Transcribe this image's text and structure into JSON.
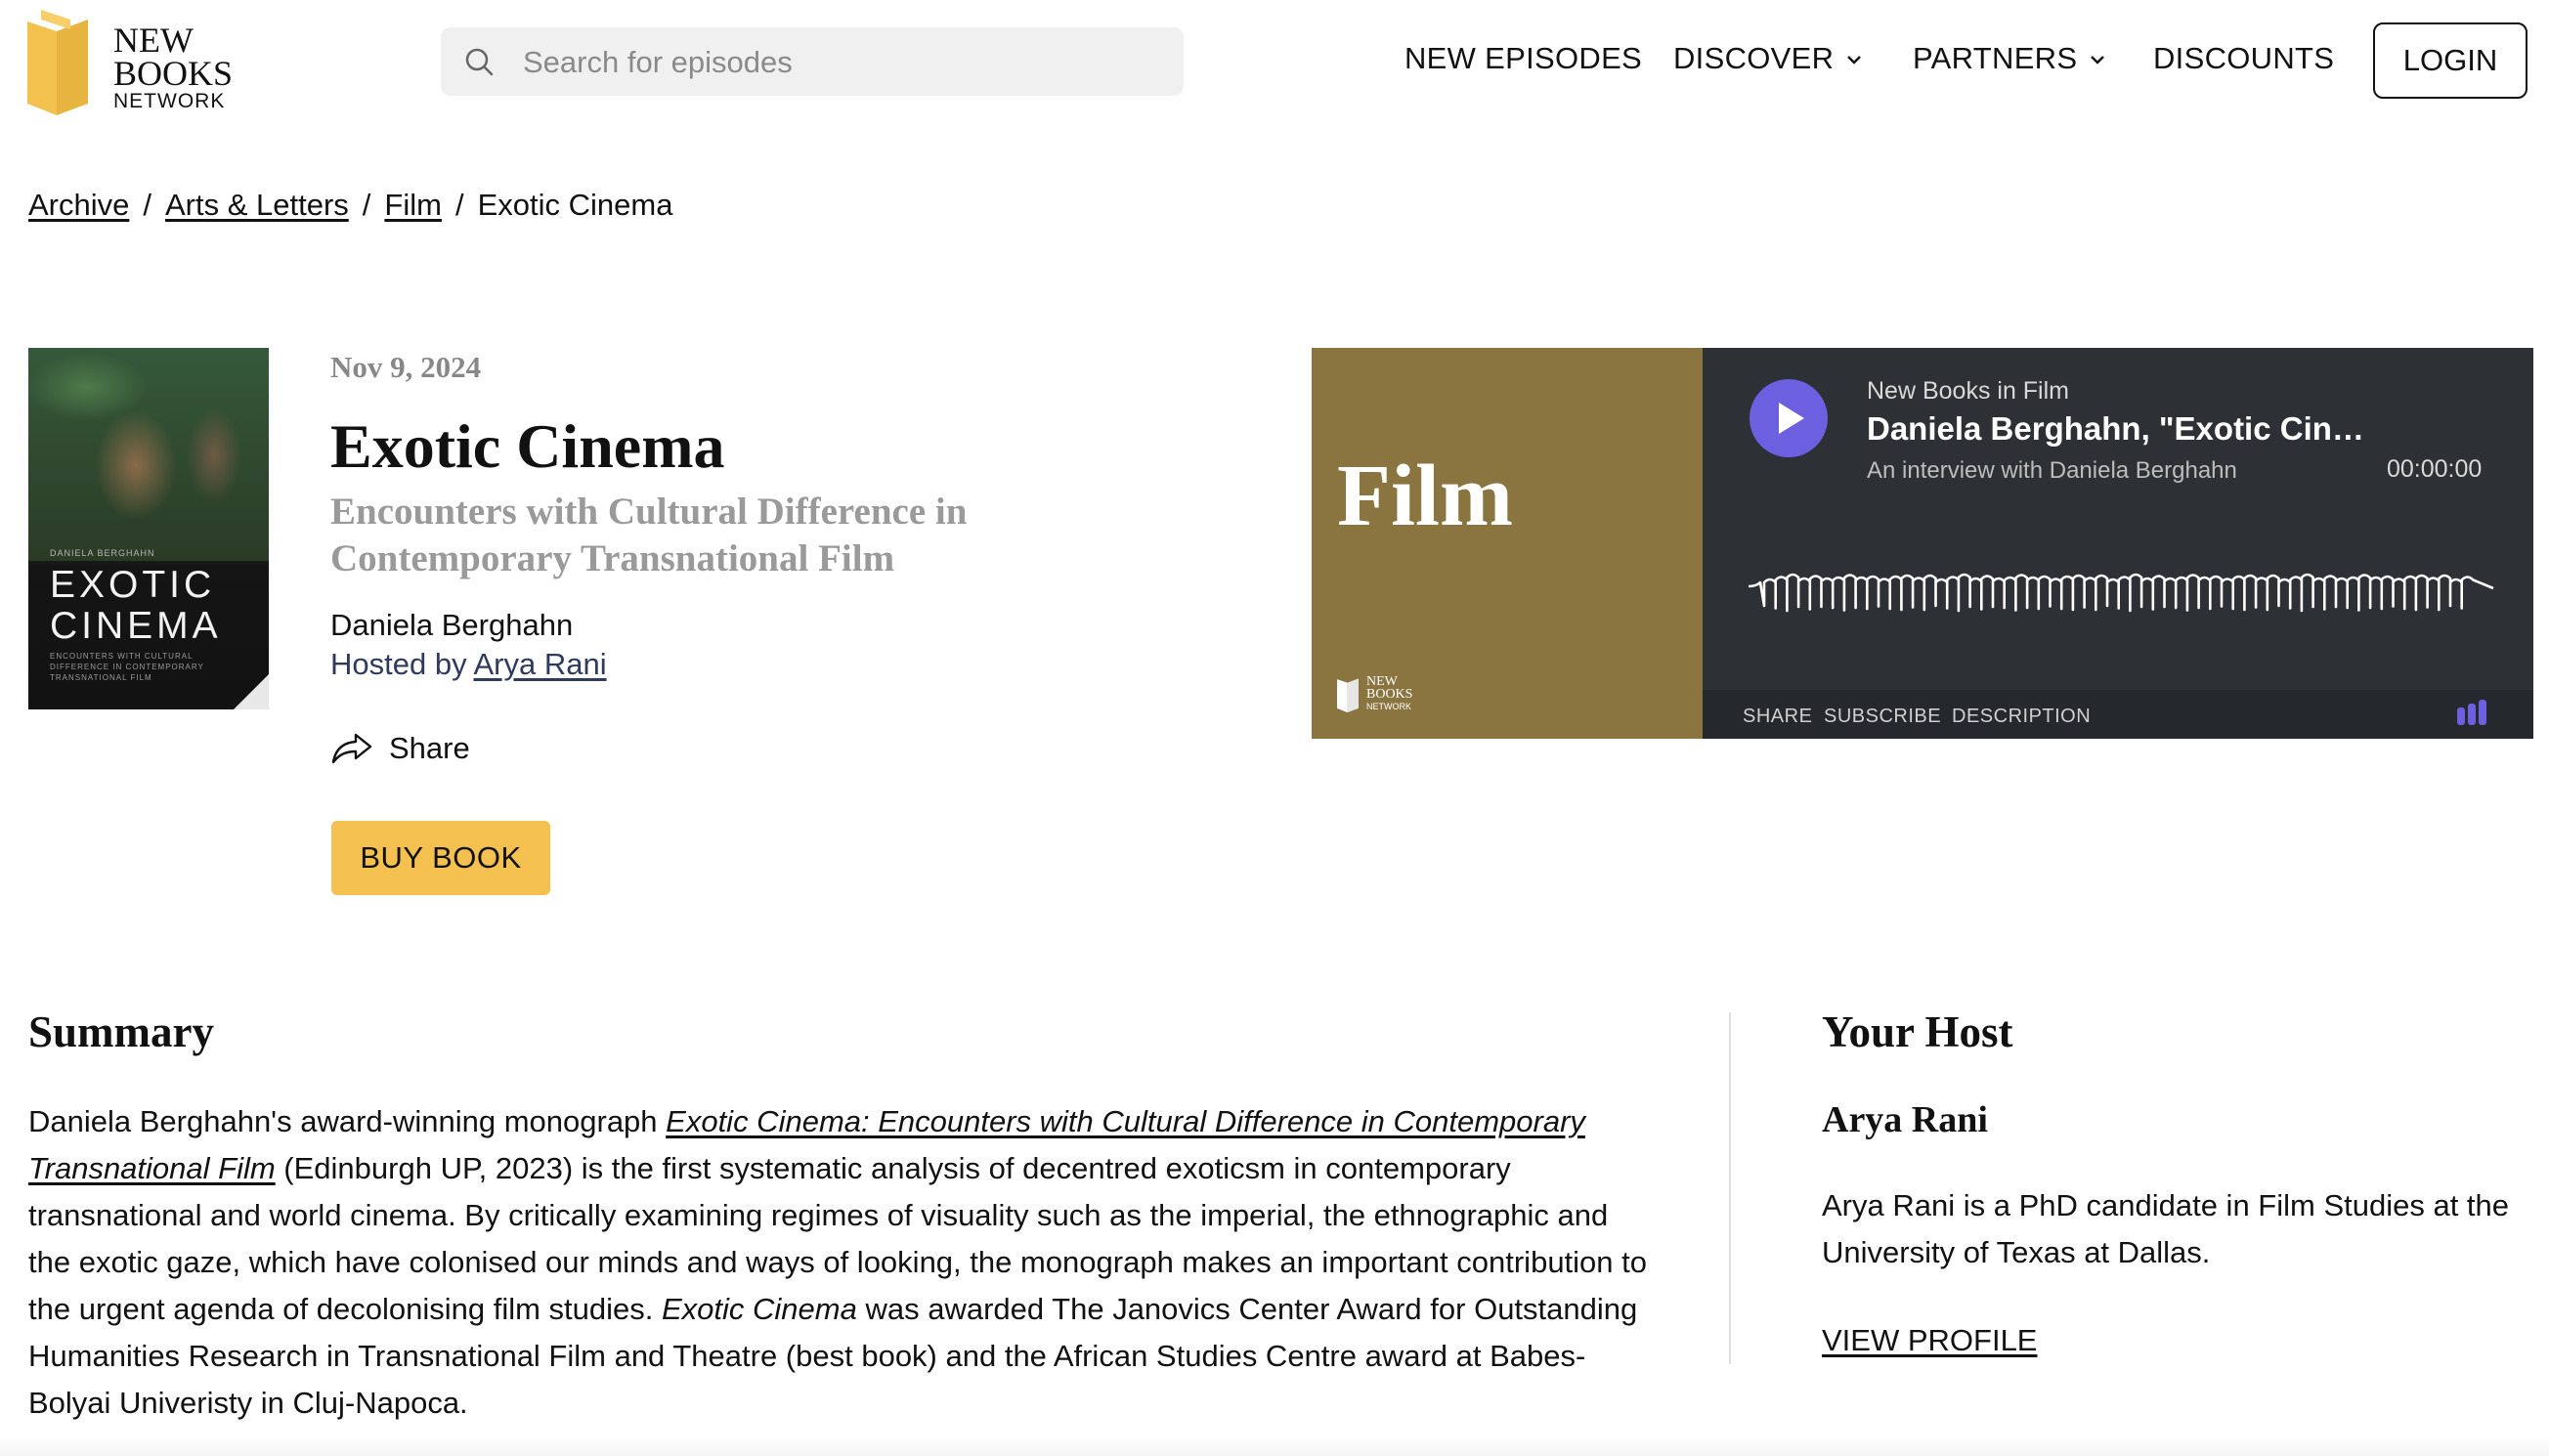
{
  "header": {
    "logo": {
      "line1": "NEW",
      "line2": "BOOKS",
      "line3": "NETWORK",
      "color": "#f2c14e"
    },
    "search": {
      "placeholder": "Search for episodes",
      "value": ""
    },
    "nav": {
      "new_episodes": "NEW EPISODES",
      "discover": "DISCOVER",
      "partners": "PARTNERS",
      "discounts": "DISCOUNTS"
    },
    "login_label": "LOGIN"
  },
  "breadcrumb": {
    "items": [
      "Archive",
      "Arts & Letters",
      "Film"
    ],
    "current": "Exotic Cinema",
    "separator": "/"
  },
  "book_cover": {
    "author_small": "DANIELA BERGHAHN",
    "title_line1": "EXOTIC",
    "title_line2": "CINEMA",
    "subtitle": "ENCOUNTERS WITH CULTURAL DIFFERENCE IN CONTEMPORARY TRANSNATIONAL FILM"
  },
  "episode": {
    "date": "Nov 9, 2024",
    "title": "Exotic Cinema",
    "subtitle": "Encounters with Cultural Difference in Contemporary Transnational Film",
    "author": "Daniela Berghahn",
    "hosted_prefix": "Hosted by",
    "host_link": "Arya Rani",
    "share_label": "Share",
    "buy_label": "BUY BOOK"
  },
  "player": {
    "art_title": "Film",
    "art_logo_line1": "NEW",
    "art_logo_line2": "BOOKS",
    "art_logo_line3": "NETWORK",
    "show_name": "New Books in Film",
    "episode_title": "Daniela Berghahn, \"Exotic Cinema: Encounters with Cultural Difference in Contemporary Transnational Film\"",
    "description": "An interview with Daniela Berghahn",
    "time": "00:00:00",
    "links": {
      "share": "SHARE",
      "subscribe": "SUBSCRIBE",
      "description": "DESCRIPTION"
    },
    "accent_color": "#6c5fe0",
    "art_color": "#8a7440"
  },
  "summary": {
    "heading": "Summary",
    "p_start": "Daniela Berghahn's award-winning monograph ",
    "book_link": "Exotic Cinema: Encounters with Cultural Difference in Contemporary Transnational Film",
    "p_middle": " (Edinburgh UP, 2023) is the first systematic analysis of decentred exoticsm in contemporary transnational and world cinema. By critically examining regimes of visuality such as the imperial, the ethnographic and the exotic gaze, which have colonised our minds and ways of looking, the monograph makes an important contribution to the urgent agenda of decolonising film studies. ",
    "italic_title": "Exotic Cinema",
    "p_end": " was awarded The Janovics Center Award for Outstanding Humanities Research in Transnational Film and Theatre (best book) and the African Studies Centre award at Babes-Bolyai Univeristy in Cluj-Napoca."
  },
  "host": {
    "heading": "Your Host",
    "name": "Arya Rani",
    "bio": "Arya Rani is a PhD candidate in Film Studies at the University of Texas at Dallas.",
    "view_profile": "VIEW PROFILE"
  },
  "colors": {
    "buy_button": "#f4c04f",
    "player_bg": "#2d3035",
    "hosted_link": "#2e3b5e"
  }
}
